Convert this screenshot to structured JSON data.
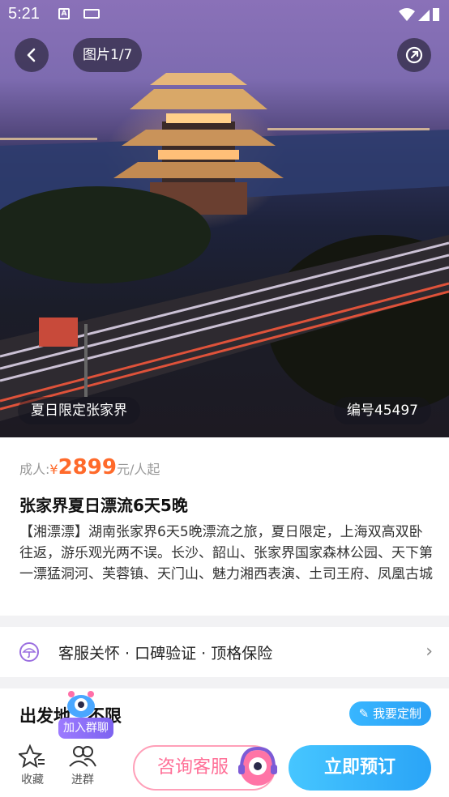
{
  "status": {
    "time": "5:21"
  },
  "hero": {
    "counter": "图片1/7",
    "tag_left": "夏日限定张家界",
    "tag_right": "编号45497"
  },
  "product": {
    "price_prefix": "成人:",
    "currency": "¥",
    "price": "2899",
    "price_suffix": "元/人起",
    "title": "张家界夏日漂流6天5晚",
    "description": "【湘漂漂】湖南张家界6天5晚漂流之旅，夏日限定，上海双高双卧往返，游乐观光两不误。长沙、韶山、张家界国家森林公园、天下第一漂猛洞河、芙蓉镇、天门山、魅力湘西表演、土司王府、凤凰古城"
  },
  "service": {
    "text": "客服关怀 · 口碑验证 · 顶格保险"
  },
  "departure": {
    "title": "出发地：不限",
    "custom_button": "我要定制"
  },
  "bottom_bar": {
    "favorite": "收藏",
    "join_group": "进群",
    "join_chat_badge": "加入群聊",
    "consult": "咨询客服",
    "book": "立即预订"
  },
  "colors": {
    "accent_price": "#ff6a2b",
    "primary_blue": "#2aa4f7",
    "consult_pink": "#ff6f97"
  }
}
